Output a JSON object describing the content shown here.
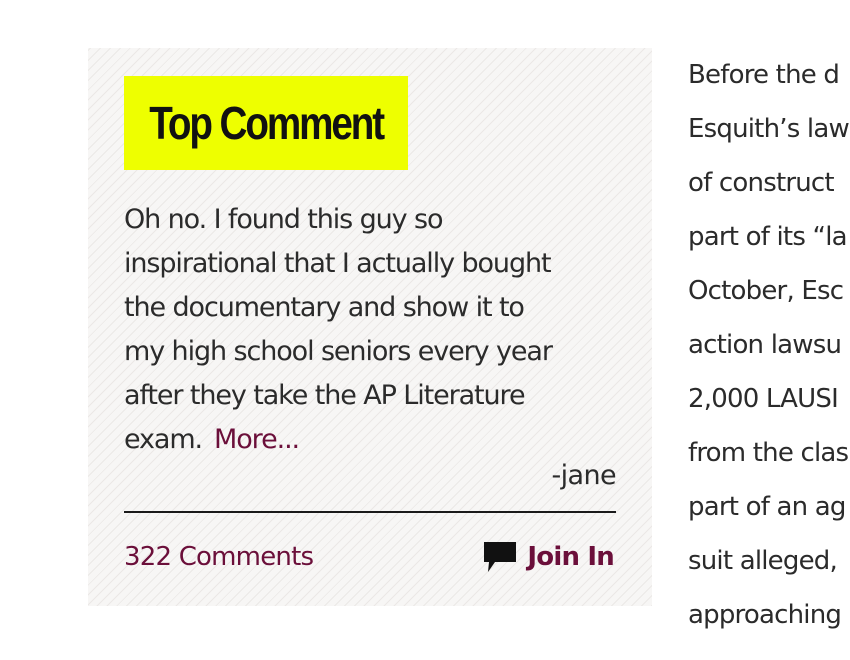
{
  "top_comment": {
    "badge_label": "Top Comment",
    "body_lines": [
      "Oh no. I found this guy so",
      "inspirational that I actually bought",
      "the documentary and show it to",
      "my high school seniors every year",
      "after they take the AP Literature",
      "exam."
    ],
    "more_label": "More...",
    "author": "-jane",
    "comments_count_label": "322 Comments",
    "join_label": "Join In",
    "join_icon": "speech-bubble-icon"
  },
  "article": {
    "lines": [
      "Before the d",
      "Esquith’s law",
      "of construct",
      "part of its “la",
      "October, Esc",
      "action lawsu",
      "2,000 LAUSI",
      "from the clas",
      "part of an ag",
      "suit alleged,",
      "approaching"
    ]
  },
  "colors": {
    "badge_background": "#eeff00",
    "link": "#6b0f3a",
    "text": "#2b2b2b"
  }
}
